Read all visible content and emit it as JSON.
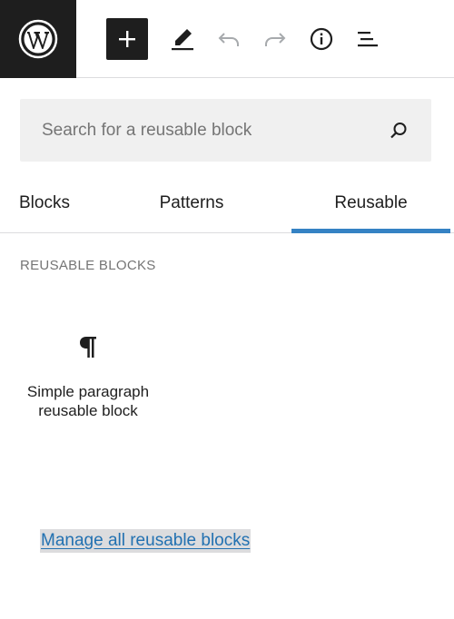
{
  "toolbar": {
    "logo_icon": "wordpress-logo-icon",
    "add_icon": "plus-icon",
    "edit_icon": "pencil-icon",
    "undo_icon": "undo-icon",
    "redo_icon": "redo-icon",
    "info_icon": "info-icon",
    "list_icon": "list-view-icon"
  },
  "search": {
    "placeholder": "Search for a reusable block",
    "value": "",
    "icon": "search-icon"
  },
  "tabs": [
    {
      "label": "Blocks",
      "active": false
    },
    {
      "label": "Patterns",
      "active": false
    },
    {
      "label": "Reusable",
      "active": true
    }
  ],
  "section": {
    "label": "REUSABLE BLOCKS"
  },
  "blocks": [
    {
      "title": "Simple paragraph reusable block",
      "icon": "paragraph-icon"
    }
  ],
  "manage_link": "Manage all reusable blocks",
  "colors": {
    "accent": "#3582c4",
    "link": "#2271b1",
    "dark": "#1e1e1e"
  }
}
